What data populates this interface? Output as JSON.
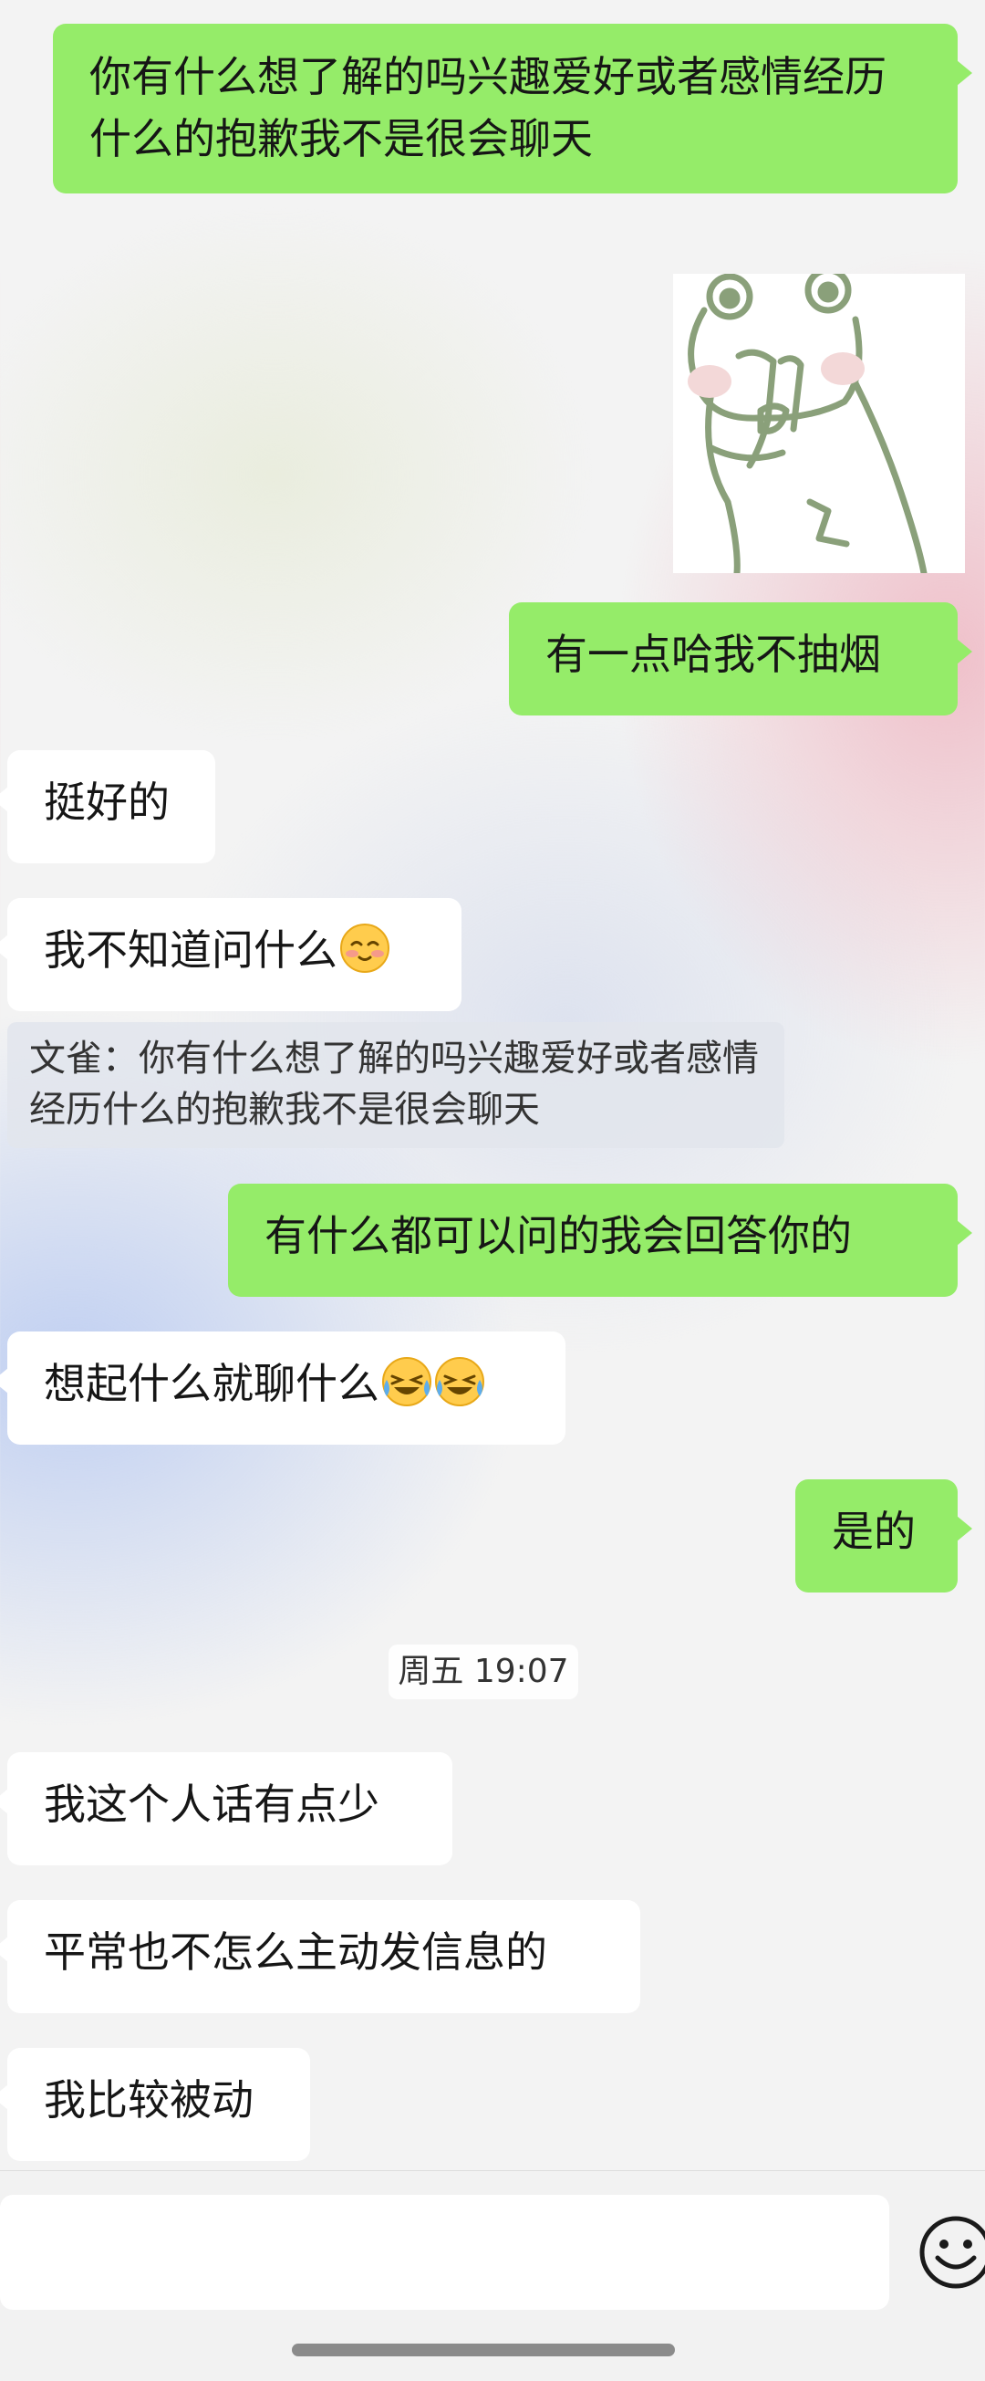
{
  "messages": [
    {
      "id": "m1",
      "side": "out",
      "text": "你有什么想了解的吗兴趣爱好或者感情经历什么的抱歉我不是很会聊天"
    },
    {
      "id": "m2",
      "side": "out",
      "type": "sticker",
      "icon": "frog-sticker-icon"
    },
    {
      "id": "m3",
      "side": "out",
      "text": "有一点哈我不抽烟"
    },
    {
      "id": "m4",
      "side": "in",
      "text": "挺好的"
    },
    {
      "id": "m5",
      "side": "in",
      "text": "我不知道问什么",
      "emoji": "blushing-face-icon"
    },
    {
      "id": "m6",
      "type": "quote",
      "text": "文雀：你有什么想了解的吗兴趣爱好或者感情经历什么的抱歉我不是很会聊天"
    },
    {
      "id": "m7",
      "side": "out",
      "text": "有什么都可以问的我会回答你的"
    },
    {
      "id": "m8",
      "side": "in",
      "text": "想起什么就聊什么",
      "emoji": "crying-laughing-face-icon"
    },
    {
      "id": "m9",
      "side": "out",
      "text": "是的"
    },
    {
      "id": "m10",
      "side": "in",
      "text": "我这个人话有点少"
    },
    {
      "id": "m11",
      "side": "in",
      "text": "平常也不怎么主动发信息的"
    },
    {
      "id": "m12",
      "side": "in",
      "text": "我比较被动"
    }
  ],
  "timestamp": "周五 19:07",
  "input_bar": {
    "text_value": "",
    "emoji_button_icon": "emoji-smiley-icon"
  },
  "colors": {
    "outgoing_bubble": "#95ec69",
    "incoming_bubble": "#ffffff"
  }
}
